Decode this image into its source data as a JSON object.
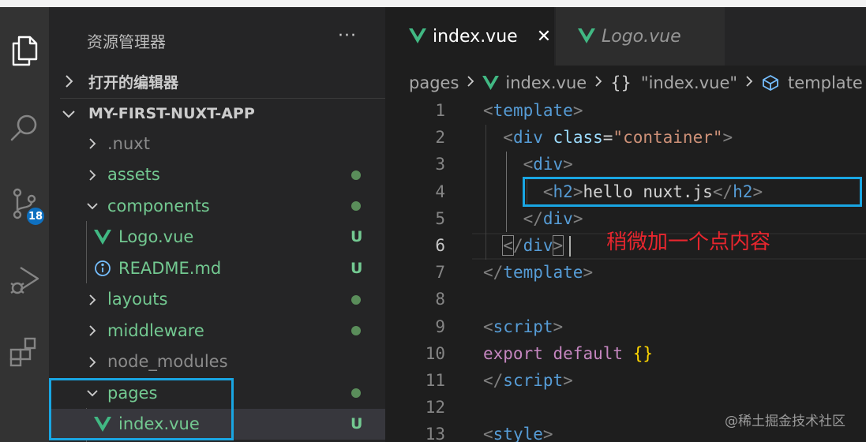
{
  "activity_bar": {
    "icons": [
      "explorer-icon",
      "search-icon",
      "source-control-icon",
      "run-debug-icon",
      "extensions-icon"
    ],
    "scm_badge": "18"
  },
  "sidebar": {
    "title": "资源管理器",
    "more_label": "···",
    "open_editors_label": "打开的编辑器",
    "project_label": "MY-FIRST-NUXT-APP",
    "tree": [
      {
        "label": ".nuxt",
        "type": "folder",
        "expanded": false,
        "color": "gray",
        "status": ""
      },
      {
        "label": "assets",
        "type": "folder",
        "expanded": false,
        "color": "green",
        "status": "dot"
      },
      {
        "label": "components",
        "type": "folder",
        "expanded": true,
        "color": "green",
        "status": "dot"
      },
      {
        "label": "Logo.vue",
        "type": "vue",
        "color": "green",
        "status": "U"
      },
      {
        "label": "README.md",
        "type": "info",
        "color": "green",
        "status": "U"
      },
      {
        "label": "layouts",
        "type": "folder",
        "expanded": false,
        "color": "green",
        "status": "dot"
      },
      {
        "label": "middleware",
        "type": "folder",
        "expanded": false,
        "color": "green",
        "status": "dot"
      },
      {
        "label": "node_modules",
        "type": "folder",
        "expanded": false,
        "color": "gray",
        "status": ""
      },
      {
        "label": "pages",
        "type": "folder",
        "expanded": true,
        "color": "green",
        "status": "dot"
      },
      {
        "label": "index.vue",
        "type": "vue",
        "color": "green",
        "status": "U"
      }
    ]
  },
  "tabs": [
    {
      "label": "index.vue",
      "active": true,
      "close": "✕"
    },
    {
      "label": "Logo.vue",
      "active": false
    }
  ],
  "breadcrumb": {
    "folder": "pages",
    "file": "index.vue",
    "braces": "{}",
    "component": "\"index.vue\"",
    "node": "template"
  },
  "editor": {
    "active_line": 6,
    "lines": [
      {
        "n": "1",
        "tokens": [
          [
            "punc",
            "<"
          ],
          [
            "tag",
            "template"
          ],
          [
            "punc",
            ">"
          ]
        ]
      },
      {
        "n": "2",
        "tokens": [
          [
            "text",
            "  "
          ],
          [
            "punc",
            "<"
          ],
          [
            "tag",
            "div"
          ],
          [
            "text",
            " "
          ],
          [
            "attr",
            "class"
          ],
          [
            "text",
            "="
          ],
          [
            "str",
            "\"container\""
          ],
          [
            "punc",
            ">"
          ]
        ]
      },
      {
        "n": "3",
        "tokens": [
          [
            "text",
            "    "
          ],
          [
            "punc",
            "<"
          ],
          [
            "tag",
            "div"
          ],
          [
            "punc",
            ">"
          ]
        ]
      },
      {
        "n": "4",
        "tokens": [
          [
            "text",
            "      "
          ],
          [
            "punc",
            "<"
          ],
          [
            "tag",
            "h2"
          ],
          [
            "punc",
            ">"
          ],
          [
            "text",
            "hello nuxt.js"
          ],
          [
            "punc",
            "</"
          ],
          [
            "tag",
            "h2"
          ],
          [
            "punc",
            ">"
          ]
        ]
      },
      {
        "n": "5",
        "tokens": [
          [
            "text",
            "    "
          ],
          [
            "punc",
            "</"
          ],
          [
            "tag",
            "div"
          ],
          [
            "punc",
            ">"
          ]
        ]
      },
      {
        "n": "6",
        "tokens": [
          [
            "text",
            "  "
          ],
          [
            "punchl",
            "<"
          ],
          [
            "punc",
            "/"
          ],
          [
            "tag",
            "div"
          ],
          [
            "punchl",
            ">"
          ]
        ]
      },
      {
        "n": "7",
        "tokens": [
          [
            "punc",
            "</"
          ],
          [
            "tag",
            "template"
          ],
          [
            "punc",
            ">"
          ]
        ]
      },
      {
        "n": "8",
        "tokens": []
      },
      {
        "n": "9",
        "tokens": [
          [
            "punc",
            "<"
          ],
          [
            "tag",
            "script"
          ],
          [
            "punc",
            ">"
          ]
        ]
      },
      {
        "n": "10",
        "tokens": [
          [
            "kw",
            "export"
          ],
          [
            "text",
            " "
          ],
          [
            "kw",
            "default"
          ],
          [
            "text",
            " "
          ],
          [
            "brace",
            "{}"
          ]
        ]
      },
      {
        "n": "11",
        "tokens": [
          [
            "punc",
            "</"
          ],
          [
            "tag",
            "script"
          ],
          [
            "punc",
            ">"
          ]
        ]
      },
      {
        "n": "12",
        "tokens": []
      },
      {
        "n": "13",
        "tokens": [
          [
            "punc",
            "<"
          ],
          [
            "tag",
            "style"
          ],
          [
            "punc",
            ">"
          ]
        ]
      }
    ]
  },
  "annotation": "稍微加一个点内容",
  "watermark": "@稀土掘金技术社区",
  "colors": {
    "highlight_box": "#19a6e3",
    "annotation": "#e8262e",
    "vue_green": "#41b883",
    "untracked_green": "#73c991"
  }
}
